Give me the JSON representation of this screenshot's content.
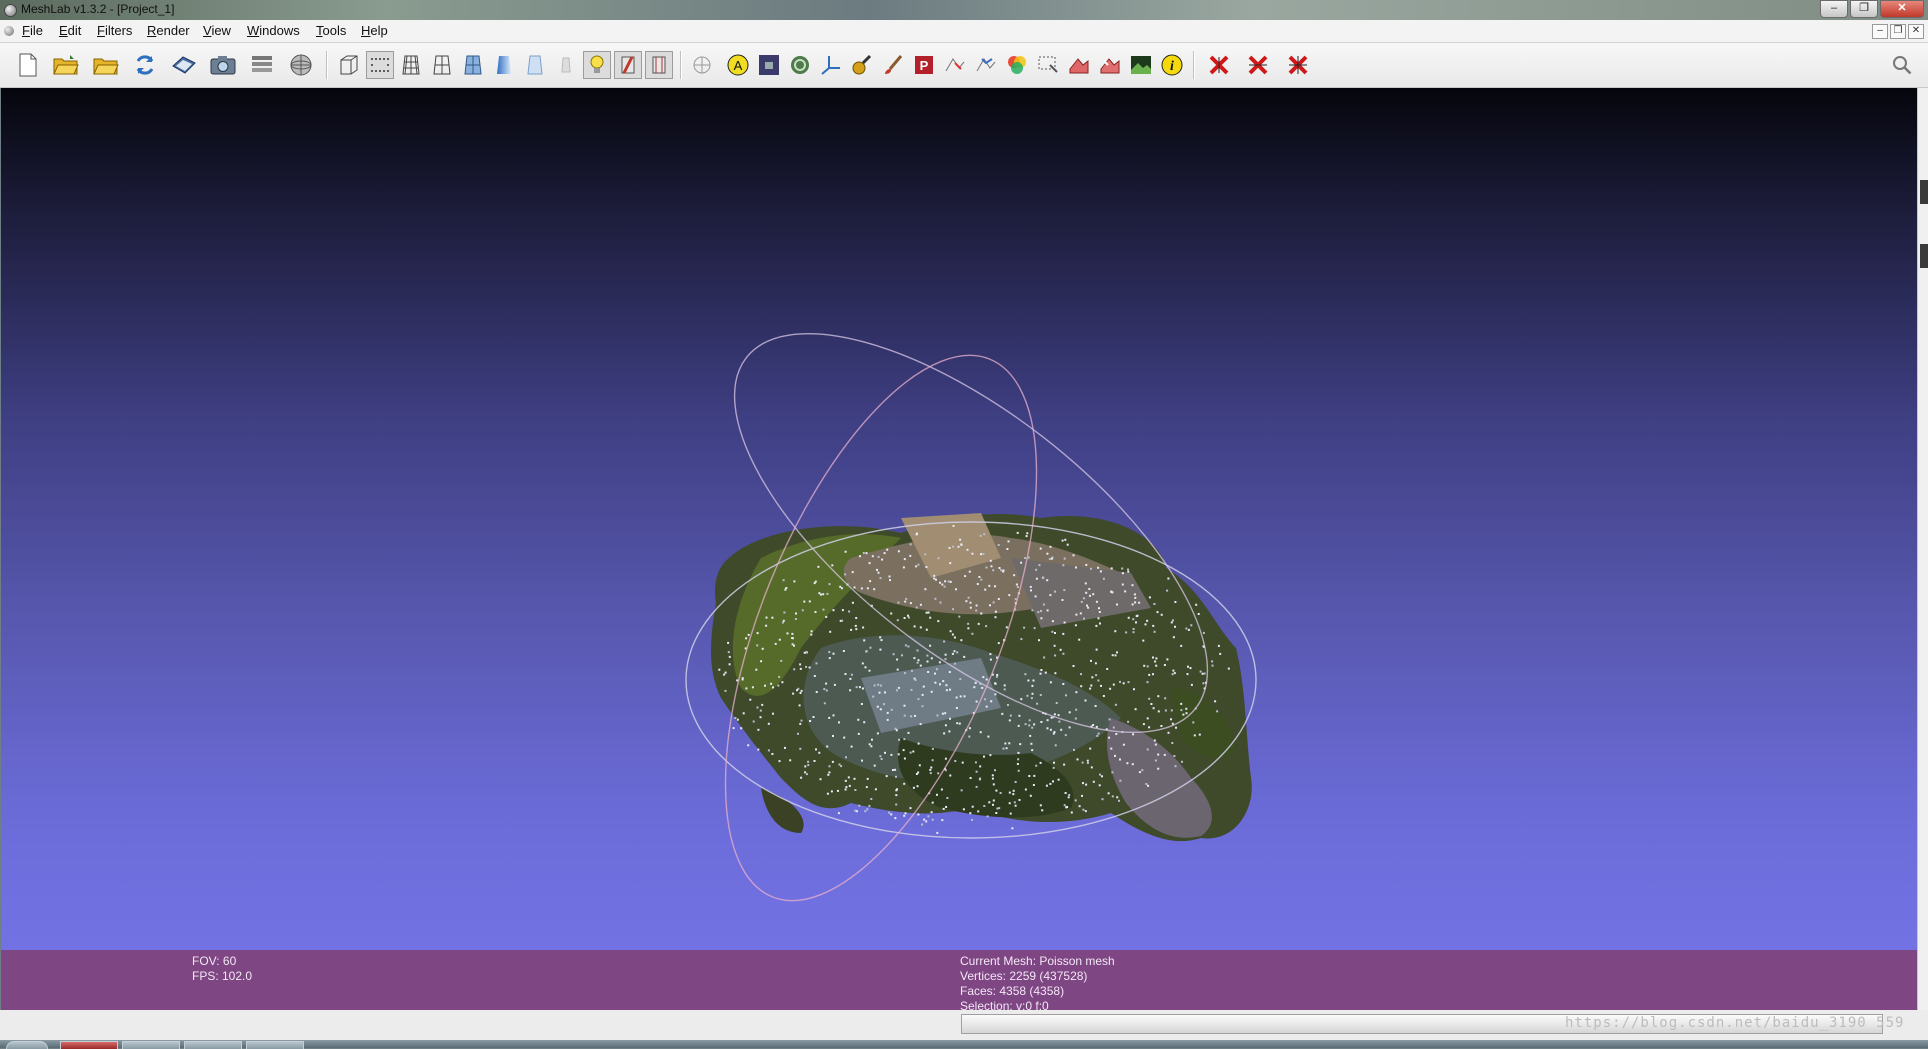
{
  "window": {
    "title": "MeshLab v1.3.2 - [Project_1]"
  },
  "menubar": {
    "items": [
      "File",
      "Edit",
      "Filters",
      "Render",
      "View",
      "Windows",
      "Tools",
      "Help"
    ]
  },
  "toolbar": {
    "buttons": [
      {
        "name": "new-project-icon"
      },
      {
        "name": "open-project-icon"
      },
      {
        "name": "import-mesh-icon"
      },
      {
        "name": "reload-icon"
      },
      {
        "name": "export-mesh-icon"
      },
      {
        "name": "snapshot-icon"
      },
      {
        "name": "layers-icon"
      },
      {
        "name": "raster-icon"
      },
      {
        "name": "bbox-mode-icon"
      },
      {
        "name": "points-mode-icon",
        "pressed": true
      },
      {
        "name": "wireframe-mode-icon"
      },
      {
        "name": "hidden-lines-mode-icon"
      },
      {
        "name": "flat-shading-icon"
      },
      {
        "name": "smooth-shading-icon"
      },
      {
        "name": "texture-mode-icon"
      },
      {
        "name": "light-icon",
        "pressed": true
      },
      {
        "name": "double-side-lighting-icon",
        "pressed": true
      },
      {
        "name": "fancy-lighting-icon",
        "pressed": true
      },
      {
        "name": "trackball-icon"
      },
      {
        "name": "align-icon"
      },
      {
        "name": "measure-tool-icon"
      },
      {
        "name": "point-picking-icon"
      },
      {
        "name": "axis-icon"
      },
      {
        "name": "paint-icon"
      },
      {
        "name": "brush-icon"
      },
      {
        "name": "parametrization-icon"
      },
      {
        "name": "select-vertices-icon"
      },
      {
        "name": "select-faces-icon"
      },
      {
        "name": "color-icon"
      },
      {
        "name": "select-area-icon"
      },
      {
        "name": "manipulator-icon"
      },
      {
        "name": "delete-vertices-icon"
      },
      {
        "name": "image-icon"
      },
      {
        "name": "info-icon"
      },
      {
        "name": "delete-selected-vertices-icon"
      },
      {
        "name": "delete-selected-faces-icon"
      },
      {
        "name": "delete-faces-vertices-icon"
      },
      {
        "name": "search-icon"
      }
    ]
  },
  "info": {
    "fov": "FOV: 60",
    "fps": "FPS:   102.0",
    "current_mesh": "Current Mesh: Poisson mesh",
    "vertices": "Vertices: 2259 (437528)",
    "faces": "Faces: 4358 (4358)",
    "selection": "Selection: v:0 f:0"
  },
  "statusbar": {
    "watermark": "https://blog.csdn.net/baidu_3190 559"
  },
  "colors": {
    "viewport_top": "#05060c",
    "viewport_bottom": "#7272e4",
    "info_panel": "#7e4682"
  }
}
